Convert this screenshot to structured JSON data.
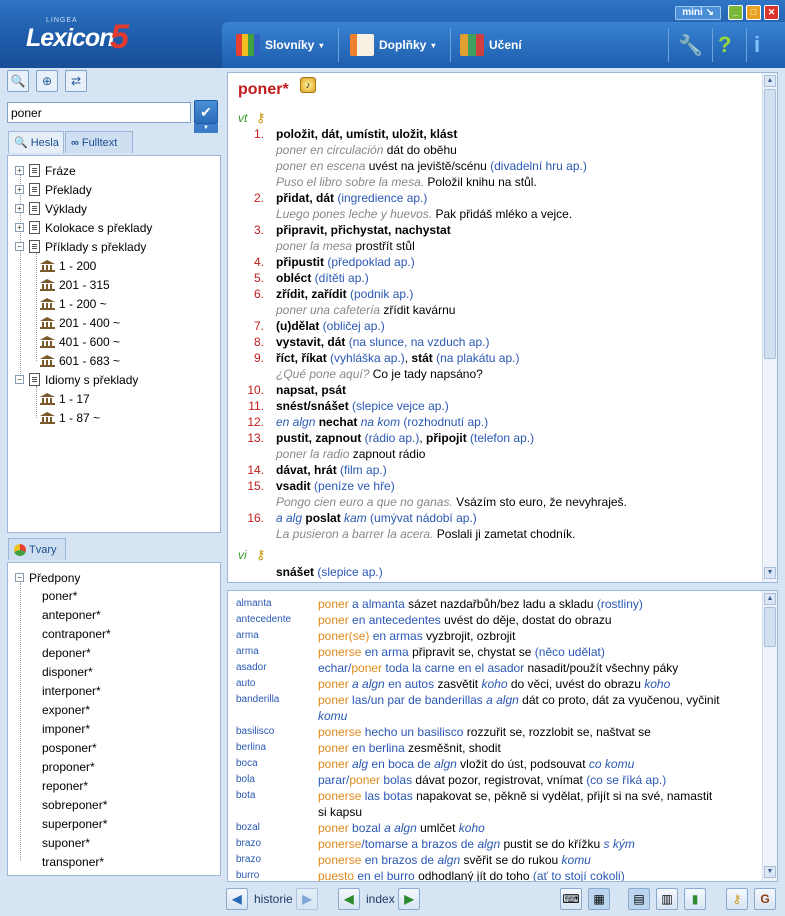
{
  "app": {
    "logo_small": "LINGEA",
    "logo_word": "Lexicon",
    "logo_number": "5",
    "mini_label": "mini"
  },
  "toolbar": {
    "dictionaries": "Slovníky",
    "addons": "Doplňky",
    "learning": "Učení"
  },
  "search": {
    "value": "poner"
  },
  "tabs": {
    "entries": "Hesla",
    "fulltext": "Fulltext",
    "forms": "Tvary"
  },
  "tree": [
    {
      "label": "Fráze",
      "sign": "+",
      "icon": "doc"
    },
    {
      "label": "Překlady",
      "sign": "+",
      "icon": "doc"
    },
    {
      "label": "Výklady",
      "sign": "+",
      "icon": "doc"
    },
    {
      "label": "Kolokace s překlady",
      "sign": "+",
      "icon": "doc"
    },
    {
      "label": "Příklady s překlady",
      "sign": "−",
      "icon": "doc"
    },
    {
      "label": "1 - 200",
      "icon": "bank"
    },
    {
      "label": "201 - 315",
      "icon": "bank"
    },
    {
      "label": "1 - 200 ~",
      "icon": "bank"
    },
    {
      "label": "201 - 400 ~",
      "icon": "bank"
    },
    {
      "label": "401 - 600 ~",
      "icon": "bank"
    },
    {
      "label": "601 - 683 ~",
      "icon": "bank"
    },
    {
      "label": "Idiomy s překlady",
      "sign": "−",
      "icon": "doc"
    },
    {
      "label": "1 - 17",
      "icon": "bank"
    },
    {
      "label": "1 - 87 ~",
      "icon": "bank"
    }
  ],
  "forms": {
    "root": "Předpony",
    "items": [
      "poner*",
      "anteponer*",
      "contraponer*",
      "deponer*",
      "disponer*",
      "interponer*",
      "exponer*",
      "imponer*",
      "posponer*",
      "proponer*",
      "reponer*",
      "sobreponer*",
      "superponer*",
      "suponer*",
      "transponer*"
    ]
  },
  "entry": {
    "headword": "poner*",
    "pos_vt": "vt",
    "pos_vi": "vi",
    "lines": [
      {
        "n": "1.",
        "parts": [
          {
            "c": "b",
            "t": "položit, dát, umístit, uložit, klást"
          }
        ]
      },
      {
        "parts": [
          {
            "c": "ex",
            "t": "poner en circulación"
          },
          {
            "c": "",
            "t": "  dát do oběhu"
          }
        ]
      },
      {
        "parts": [
          {
            "c": "ex",
            "t": "poner en escena"
          },
          {
            "c": "",
            "t": "  uvést na jeviště/scénu "
          },
          {
            "c": "note",
            "t": "(divadelní hru ap.)"
          }
        ]
      },
      {
        "parts": [
          {
            "c": "ex",
            "t": "Puso el libro sobre la mesa."
          },
          {
            "c": "",
            "t": "  Položil knihu na stůl."
          }
        ]
      },
      {
        "n": "2.",
        "parts": [
          {
            "c": "b",
            "t": "přidat, dát"
          },
          {
            "c": "note",
            "t": " (ingredience ap.)"
          }
        ]
      },
      {
        "parts": [
          {
            "c": "ex",
            "t": "Luego pones leche y huevos."
          },
          {
            "c": "",
            "t": "  Pak přidáš mléko a vejce."
          }
        ]
      },
      {
        "n": "3.",
        "parts": [
          {
            "c": "b",
            "t": "připravit, přichystat, nachystat"
          }
        ]
      },
      {
        "parts": [
          {
            "c": "ex",
            "t": "poner la mesa"
          },
          {
            "c": "",
            "t": "  prostřít stůl"
          }
        ]
      },
      {
        "n": "4.",
        "parts": [
          {
            "c": "b",
            "t": "připustit"
          },
          {
            "c": "note",
            "t": " (předpoklad ap.)"
          }
        ]
      },
      {
        "n": "5.",
        "parts": [
          {
            "c": "b",
            "t": "obléct"
          },
          {
            "c": "note",
            "t": " (dítěti ap.)"
          }
        ]
      },
      {
        "n": "6.",
        "parts": [
          {
            "c": "b",
            "t": "zřídit, zařídit"
          },
          {
            "c": "note",
            "t": " (podnik ap.)"
          }
        ]
      },
      {
        "parts": [
          {
            "c": "ex",
            "t": "poner una cafetería"
          },
          {
            "c": "",
            "t": "  zřídit kavárnu"
          }
        ]
      },
      {
        "n": "7.",
        "parts": [
          {
            "c": "b",
            "t": "(u)dělat"
          },
          {
            "c": "note",
            "t": " (obličej ap.)"
          }
        ]
      },
      {
        "n": "8.",
        "parts": [
          {
            "c": "b",
            "t": "vystavit, dát"
          },
          {
            "c": "note",
            "t": " (na slunce, na vzduch ap.)"
          }
        ]
      },
      {
        "n": "9.",
        "parts": [
          {
            "c": "b",
            "t": "říct, říkat"
          },
          {
            "c": "note",
            "t": " (vyhláška ap.)"
          },
          {
            "c": "",
            "t": ", "
          },
          {
            "c": "b",
            "t": "stát"
          },
          {
            "c": "note",
            "t": " (na plakátu ap.)"
          }
        ]
      },
      {
        "parts": [
          {
            "c": "ex",
            "t": "¿Qué pone aquí?"
          },
          {
            "c": "",
            "t": "  Co je tady napsáno?"
          }
        ]
      },
      {
        "n": "10.",
        "parts": [
          {
            "c": "b",
            "t": "napsat, psát"
          }
        ]
      },
      {
        "n": "11.",
        "parts": [
          {
            "c": "b",
            "t": "snést/snášet"
          },
          {
            "c": "note",
            "t": " (slepice vejce ap.)"
          }
        ]
      },
      {
        "n": "12.",
        "parts": [
          {
            "c": "it",
            "t": "en algn"
          },
          {
            "c": "b",
            "t": " nechat "
          },
          {
            "c": "it",
            "t": "na kom"
          },
          {
            "c": "note",
            "t": " (rozhodnutí ap.)"
          }
        ]
      },
      {
        "n": "13.",
        "parts": [
          {
            "c": "b",
            "t": "pustit, zapnout"
          },
          {
            "c": "note",
            "t": " (rádio ap.)"
          },
          {
            "c": "",
            "t": ", "
          },
          {
            "c": "b",
            "t": "připojit"
          },
          {
            "c": "note",
            "t": " (telefon ap.)"
          }
        ]
      },
      {
        "parts": [
          {
            "c": "ex",
            "t": "poner la radio"
          },
          {
            "c": "",
            "t": "  zapnout rádio"
          }
        ]
      },
      {
        "n": "14.",
        "parts": [
          {
            "c": "b",
            "t": "dávat, hrát"
          },
          {
            "c": "note",
            "t": " (film ap.)"
          }
        ]
      },
      {
        "n": "15.",
        "parts": [
          {
            "c": "b",
            "t": "vsadit"
          },
          {
            "c": "note",
            "t": " (peníze ve hře)"
          }
        ]
      },
      {
        "parts": [
          {
            "c": "ex",
            "t": "Pongo cien euro a que no ganas."
          },
          {
            "c": "",
            "t": "  Vsázím sto euro, že nevyhraješ."
          }
        ]
      },
      {
        "n": "16.",
        "parts": [
          {
            "c": "it",
            "t": "a alg"
          },
          {
            "c": "b",
            "t": " poslat "
          },
          {
            "c": "it",
            "t": "kam"
          },
          {
            "c": "note",
            "t": " (umývat nádobí ap.)"
          }
        ]
      },
      {
        "parts": [
          {
            "c": "ex",
            "t": "La pusieron a barrer la acera."
          },
          {
            "c": "",
            "t": "  Poslali ji zametat chodník."
          }
        ]
      }
    ],
    "vi_line": [
      {
        "c": "b",
        "t": "snášet"
      },
      {
        "c": "note",
        "t": " (slepice ap.)"
      }
    ]
  },
  "phrases": [
    {
      "kw": "almanta",
      "parts": [
        {
          "c": "or",
          "t": "poner"
        },
        {
          "c": "bl",
          "t": " a almanta"
        },
        {
          "c": "",
          "t": "  sázet nazdařbůh/bez ladu a skladu "
        },
        {
          "c": "bl",
          "t": "(rostliny)"
        }
      ]
    },
    {
      "kw": "antecedente",
      "parts": [
        {
          "c": "or",
          "t": "poner"
        },
        {
          "c": "bl",
          "t": " en antecedentes"
        },
        {
          "c": "",
          "t": "  uvést do děje, dostat do obrazu"
        }
      ]
    },
    {
      "kw": "arma",
      "parts": [
        {
          "c": "or",
          "t": "poner(se)"
        },
        {
          "c": "bl",
          "t": " en armas"
        },
        {
          "c": "",
          "t": "  vyzbrojit, ozbrojit"
        }
      ]
    },
    {
      "kw": "arma",
      "parts": [
        {
          "c": "or",
          "t": "ponerse"
        },
        {
          "c": "bl",
          "t": " en arma"
        },
        {
          "c": "",
          "t": "  připravit se, chystat se "
        },
        {
          "c": "bl",
          "t": "(něco udělat)"
        }
      ]
    },
    {
      "kw": "asador",
      "parts": [
        {
          "c": "bl",
          "t": "echar/"
        },
        {
          "c": "or",
          "t": "poner"
        },
        {
          "c": "bl",
          "t": " toda la carne en el asador"
        },
        {
          "c": "",
          "t": "  nasadit/použít všechny páky"
        }
      ]
    },
    {
      "kw": "auto",
      "parts": [
        {
          "c": "or",
          "t": "poner"
        },
        {
          "c": "it",
          "t": " a algn"
        },
        {
          "c": "bl",
          "t": " en autos"
        },
        {
          "c": "",
          "t": "  zasvětit "
        },
        {
          "c": "it",
          "t": "koho"
        },
        {
          "c": "",
          "t": " do věci, uvést do obrazu "
        },
        {
          "c": "it",
          "t": "koho"
        }
      ]
    },
    {
      "kw": "banderilla",
      "parts": [
        {
          "c": "or",
          "t": "poner"
        },
        {
          "c": "bl",
          "t": " las/un par de banderillas "
        },
        {
          "c": "it",
          "t": "a algn"
        },
        {
          "c": "",
          "t": "  dát co proto, dát za vyučenou, vyčinit"
        }
      ],
      "cont": [
        {
          "c": "it",
          "t": "komu"
        }
      ]
    },
    {
      "kw": "basilisco",
      "parts": [
        {
          "c": "or",
          "t": "ponerse"
        },
        {
          "c": "bl",
          "t": " hecho un basilisco"
        },
        {
          "c": "",
          "t": "  rozzuřit se, rozzlobit se, naštvat se"
        }
      ]
    },
    {
      "kw": "berlina",
      "parts": [
        {
          "c": "or",
          "t": "poner"
        },
        {
          "c": "bl",
          "t": " en berlina"
        },
        {
          "c": "",
          "t": "  zesměšnit, shodit"
        }
      ]
    },
    {
      "kw": "boca",
      "parts": [
        {
          "c": "or",
          "t": "poner"
        },
        {
          "c": "it",
          "t": " alg"
        },
        {
          "c": "bl",
          "t": " en boca de "
        },
        {
          "c": "it",
          "t": "algn"
        },
        {
          "c": "",
          "t": "  vložit do úst, podsouvat "
        },
        {
          "c": "it",
          "t": "co komu"
        }
      ]
    },
    {
      "kw": "bola",
      "parts": [
        {
          "c": "bl",
          "t": "parar/"
        },
        {
          "c": "or",
          "t": "poner"
        },
        {
          "c": "bl",
          "t": " bolas"
        },
        {
          "c": "",
          "t": "  dávat pozor, registrovat, vnímat "
        },
        {
          "c": "bl",
          "t": "(co se říká ap.)"
        }
      ]
    },
    {
      "kw": "bota",
      "parts": [
        {
          "c": "or",
          "t": "ponerse"
        },
        {
          "c": "bl",
          "t": " las botas"
        },
        {
          "c": "",
          "t": "  napakovat se, pěkně si vydělat, přijít si na své, namastit"
        }
      ],
      "cont": [
        {
          "c": "",
          "t": "si kapsu"
        }
      ]
    },
    {
      "kw": "bozal",
      "parts": [
        {
          "c": "or",
          "t": "poner"
        },
        {
          "c": "bl",
          "t": " bozal "
        },
        {
          "c": "it",
          "t": "a algn"
        },
        {
          "c": "",
          "t": "  umlčet "
        },
        {
          "c": "it",
          "t": "koho"
        }
      ]
    },
    {
      "kw": "brazo",
      "parts": [
        {
          "c": "or",
          "t": "ponerse"
        },
        {
          "c": "bl",
          "t": "/tomarse a brazos de "
        },
        {
          "c": "it",
          "t": "algn"
        },
        {
          "c": "",
          "t": "  pustit se do křížku "
        },
        {
          "c": "it",
          "t": "s kým"
        }
      ]
    },
    {
      "kw": "brazo",
      "parts": [
        {
          "c": "or",
          "t": "ponerse"
        },
        {
          "c": "bl",
          "t": " en brazos de "
        },
        {
          "c": "it",
          "t": "algn"
        },
        {
          "c": "",
          "t": "  svěřit se do rukou "
        },
        {
          "c": "it",
          "t": "komu"
        }
      ]
    },
    {
      "kw": "burro",
      "parts": [
        {
          "c": "or",
          "t": "puesto"
        },
        {
          "c": "bl",
          "t": " en el burro"
        },
        {
          "c": "",
          "t": "  odhodlaný jít do toho "
        },
        {
          "c": "bl",
          "t": "(ať to stojí cokoli)"
        }
      ]
    }
  ],
  "bottom": {
    "history": "historie",
    "index": "index"
  },
  "colors": {
    "accent": "#1d5aa8",
    "headword": "#c21b1b",
    "orange": "#e08a1a",
    "blue": "#2a58b4"
  }
}
